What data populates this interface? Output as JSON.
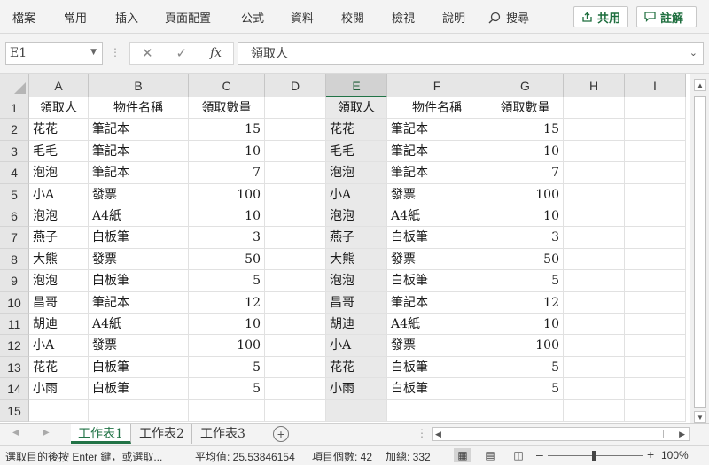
{
  "ribbon": {
    "tabs": [
      "檔案",
      "常用",
      "插入",
      "頁面配置",
      "公式",
      "資料",
      "校閱",
      "檢視",
      "說明"
    ],
    "search_label": "搜尋",
    "share_label": "共用",
    "comment_label": "註解"
  },
  "formula_bar": {
    "name_box": "E1",
    "formula": "領取人",
    "fx_label": "fx"
  },
  "grid": {
    "columns": [
      "A",
      "B",
      "C",
      "D",
      "E",
      "F",
      "G",
      "H",
      "I"
    ],
    "selected_column": "E",
    "rows": [
      "1",
      "2",
      "3",
      "4",
      "5",
      "6",
      "7",
      "8",
      "9",
      "10",
      "11",
      "12",
      "13",
      "14",
      "15"
    ],
    "headers": [
      "領取人",
      "物件名稱",
      "領取數量"
    ],
    "records": [
      [
        "花花",
        "筆記本",
        "15"
      ],
      [
        "毛毛",
        "筆記本",
        "10"
      ],
      [
        "泡泡",
        "筆記本",
        "7"
      ],
      [
        "小A",
        "發票",
        "100"
      ],
      [
        "泡泡",
        "A4紙",
        "10"
      ],
      [
        "燕子",
        "白板筆",
        "3"
      ],
      [
        "大熊",
        "發票",
        "50"
      ],
      [
        "泡泡",
        "白板筆",
        "5"
      ],
      [
        "昌哥",
        "筆記本",
        "12"
      ],
      [
        "胡迪",
        "A4紙",
        "10"
      ],
      [
        "小A",
        "發票",
        "100"
      ],
      [
        "花花",
        "白板筆",
        "5"
      ],
      [
        "小雨",
        "白板筆",
        "5"
      ]
    ]
  },
  "sheets": {
    "tabs": [
      "工作表1",
      "工作表2",
      "工作表3"
    ],
    "active_index": 0
  },
  "status": {
    "mode_text": "選取目的後按 Enter 鍵，或選取...",
    "average": "平均值: 25.53846154",
    "count": "項目個數: 42",
    "sum": "加總: 332",
    "zoom": "100%"
  }
}
